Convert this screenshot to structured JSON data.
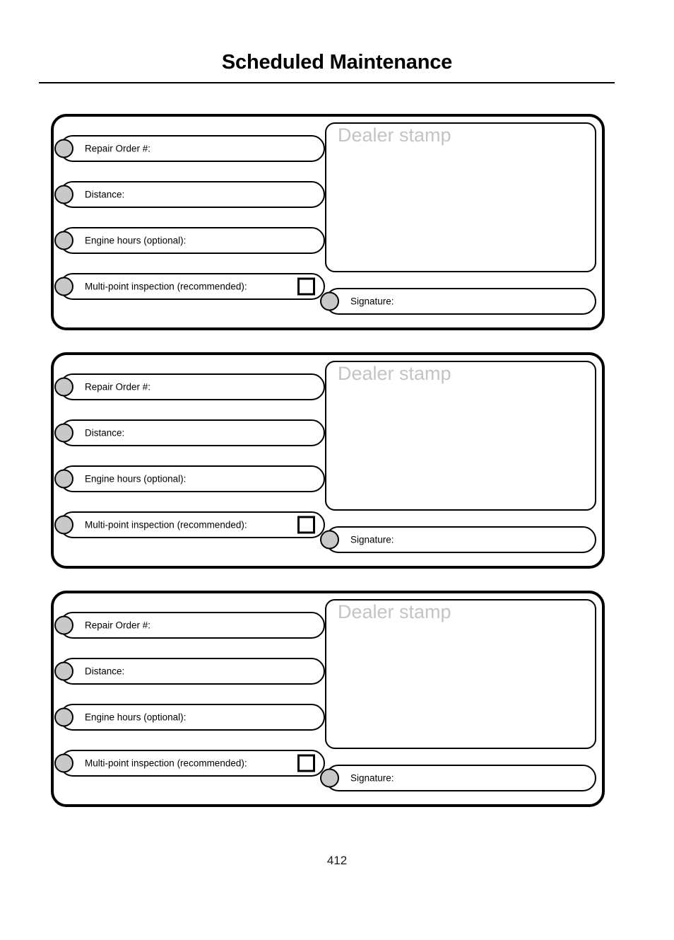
{
  "header": {
    "title": "Scheduled Maintenance"
  },
  "footer": {
    "page_number": "412"
  },
  "colors": {
    "bullet_fill": "#c8c8c8",
    "stamp_text": "#c4c4c4",
    "border": "#000000",
    "background": "#ffffff"
  },
  "record_cards": [
    {
      "fields": [
        {
          "label": "Repair Order #:",
          "has_checkbox": false
        },
        {
          "label": "Distance:",
          "has_checkbox": false
        },
        {
          "label": "Engine hours (optional):",
          "has_checkbox": false
        },
        {
          "label": "Multi-point inspection (recommended):",
          "has_checkbox": true
        }
      ],
      "stamp_label": "Dealer stamp",
      "signature_label": "Signature:"
    },
    {
      "fields": [
        {
          "label": "Repair Order #:",
          "has_checkbox": false
        },
        {
          "label": "Distance:",
          "has_checkbox": false
        },
        {
          "label": "Engine hours (optional):",
          "has_checkbox": false
        },
        {
          "label": "Multi-point inspection (recommended):",
          "has_checkbox": true
        }
      ],
      "stamp_label": "Dealer stamp",
      "signature_label": "Signature:"
    },
    {
      "fields": [
        {
          "label": "Repair Order #:",
          "has_checkbox": false
        },
        {
          "label": "Distance:",
          "has_checkbox": false
        },
        {
          "label": "Engine hours (optional):",
          "has_checkbox": false
        },
        {
          "label": "Multi-point inspection (recommended):",
          "has_checkbox": true
        }
      ],
      "stamp_label": "Dealer stamp",
      "signature_label": "Signature:"
    }
  ]
}
